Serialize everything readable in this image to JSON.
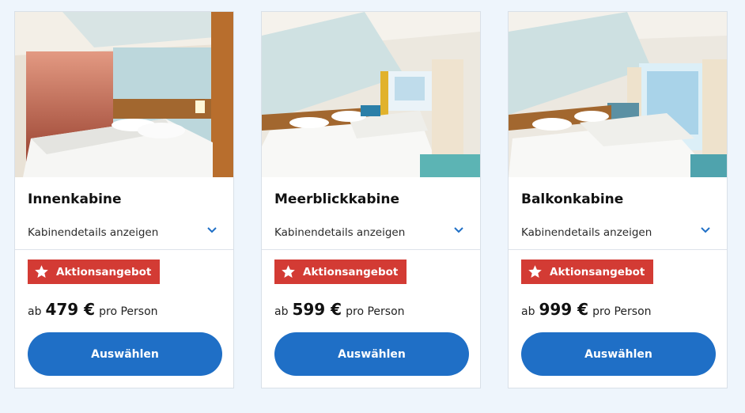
{
  "colors": {
    "page_background": "#eef5fc",
    "badge": "#d33b34",
    "button": "#1f6fc6",
    "chevron": "#1f6fc6"
  },
  "cards": [
    {
      "photo_alt": "inside-cabin-photo",
      "title": "Innenkabine",
      "details_label": "Kabinendetails anzeigen",
      "badge_label": "Aktionsangebot",
      "price_prefix": "ab",
      "price_amount": "479 €",
      "price_suffix": "pro Person",
      "button_label": "Auswählen"
    },
    {
      "photo_alt": "sea-view-cabin-photo",
      "title": "Meerblickkabine",
      "details_label": "Kabinendetails anzeigen",
      "badge_label": "Aktionsangebot",
      "price_prefix": "ab",
      "price_amount": "599 €",
      "price_suffix": "pro Person",
      "button_label": "Auswählen"
    },
    {
      "photo_alt": "balcony-cabin-photo",
      "title": "Balkonkabine",
      "details_label": "Kabinendetails anzeigen",
      "badge_label": "Aktionsangebot",
      "price_prefix": "ab",
      "price_amount": "999 €",
      "price_suffix": "pro Person",
      "button_label": "Auswählen"
    }
  ]
}
